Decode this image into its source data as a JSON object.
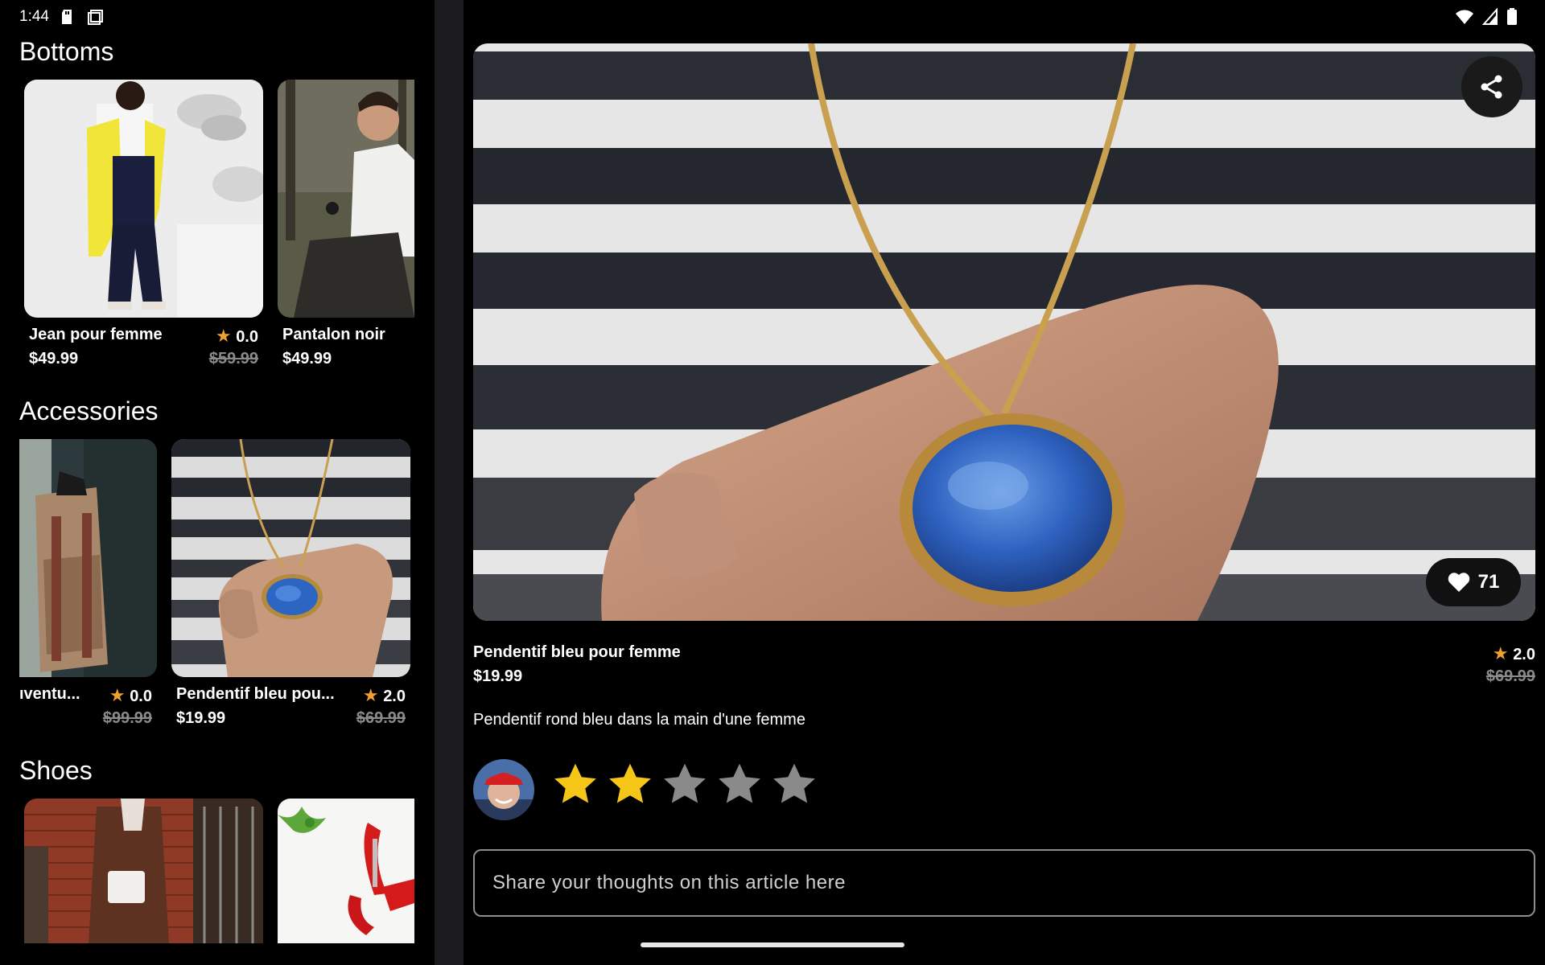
{
  "status": {
    "time": "1:44"
  },
  "sections": {
    "bottoms": {
      "title": "Bottoms",
      "items": [
        {
          "name": "Jean pour femme",
          "price": "$49.99",
          "rating": "0.0",
          "old_price": "$59.99"
        },
        {
          "name": "Pantalon noir",
          "price": "$49.99"
        }
      ]
    },
    "accessories": {
      "title": "Accessories",
      "items": [
        {
          "name": "ıventu...",
          "rating": "0.0",
          "old_price": "$99.99"
        },
        {
          "name": "Pendentif bleu pou...",
          "price": "$19.99",
          "rating": "2.0",
          "old_price": "$69.99"
        }
      ]
    },
    "shoes": {
      "title": "Shoes"
    }
  },
  "detail": {
    "name": "Pendentif bleu pour femme",
    "price": "$19.99",
    "rating": "2.0",
    "old_price": "$69.99",
    "description": "Pendentif rond bleu dans la main d'une femme",
    "likes": "71",
    "user_rating": 2,
    "max_rating": 5,
    "comment_placeholder": "Share your thoughts on this article here"
  },
  "colors": {
    "star_active": "#f5c518",
    "star_inactive": "#8a8a8a",
    "star_small": "#f0a030"
  },
  "icons": [
    "sd-card-icon",
    "screenshot-icon",
    "wifi-icon",
    "signal-icon",
    "battery-icon",
    "share-icon",
    "heart-icon",
    "star-icon"
  ]
}
